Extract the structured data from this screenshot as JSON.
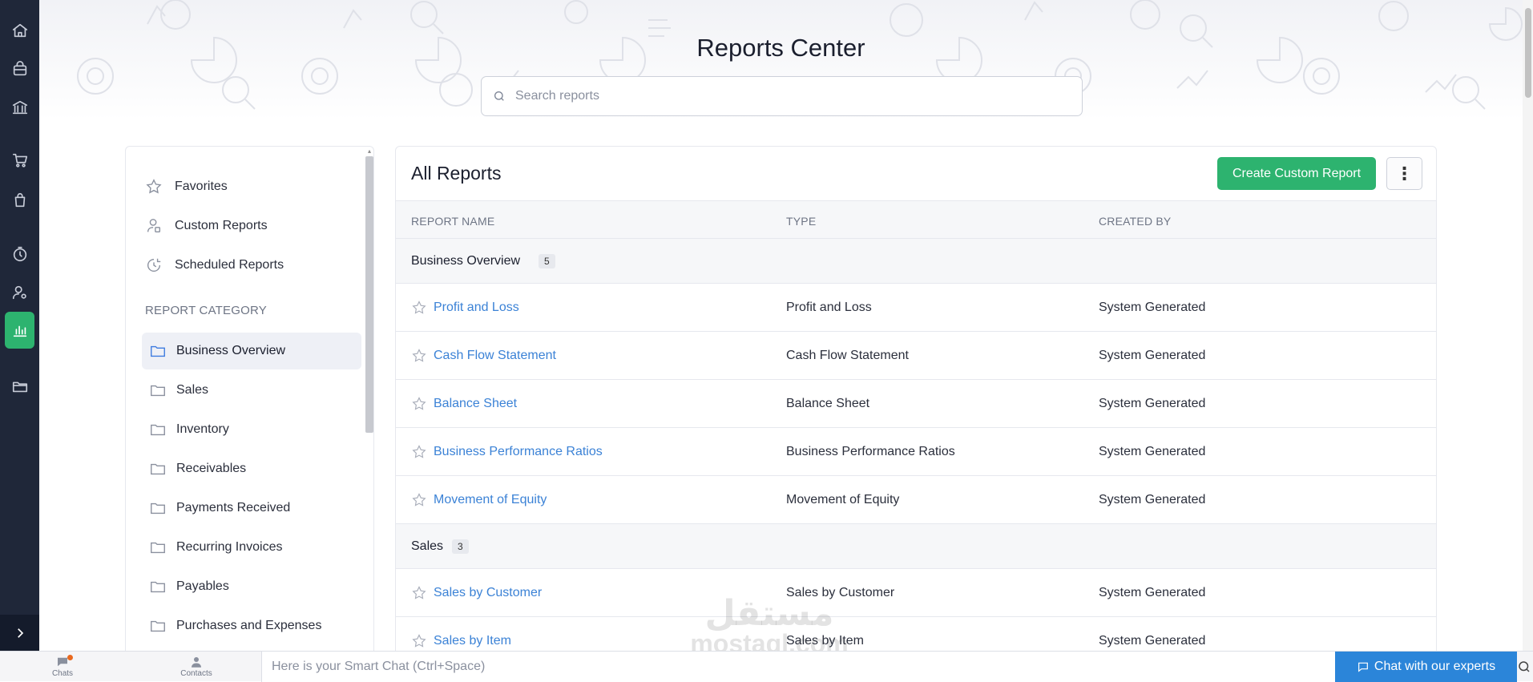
{
  "page": {
    "title": "Reports Center"
  },
  "search": {
    "placeholder": "Search reports"
  },
  "rail": {
    "items": [
      "home-icon",
      "shopping-bag-icon",
      "bank-icon",
      "cart-icon",
      "bag-icon",
      "timer-icon",
      "user-settings-icon",
      "reports-icon",
      "folder-icon"
    ],
    "active": "reports-icon",
    "active_color": "#2db36f"
  },
  "sidebar": {
    "links": [
      {
        "label": "Favorites",
        "icon": "star-icon"
      },
      {
        "label": "Custom Reports",
        "icon": "custom-report-icon"
      },
      {
        "label": "Scheduled Reports",
        "icon": "schedule-icon"
      }
    ],
    "category_heading": "REPORT CATEGORY",
    "categories": [
      {
        "label": "Business Overview",
        "active": true
      },
      {
        "label": "Sales"
      },
      {
        "label": "Inventory"
      },
      {
        "label": "Receivables"
      },
      {
        "label": "Payments Received"
      },
      {
        "label": "Recurring Invoices"
      },
      {
        "label": "Payables"
      },
      {
        "label": "Purchases and Expenses"
      }
    ]
  },
  "main": {
    "title": "All Reports",
    "create_button": "Create Custom Report",
    "columns": [
      "REPORT NAME",
      "TYPE",
      "CREATED BY"
    ],
    "groups": [
      {
        "name": "Business Overview",
        "count": "5",
        "rows": [
          {
            "name": "Profit and Loss",
            "type": "Profit and Loss",
            "created_by": "System Generated"
          },
          {
            "name": "Cash Flow Statement",
            "type": "Cash Flow Statement",
            "created_by": "System Generated"
          },
          {
            "name": "Balance Sheet",
            "type": "Balance Sheet",
            "created_by": "System Generated"
          },
          {
            "name": "Business Performance Ratios",
            "type": "Business Performance Ratios",
            "created_by": "System Generated"
          },
          {
            "name": "Movement of Equity",
            "type": "Movement of Equity",
            "created_by": "System Generated"
          }
        ]
      },
      {
        "name": "Sales",
        "count": "3",
        "rows": [
          {
            "name": "Sales by Customer",
            "type": "Sales by Customer",
            "created_by": "System Generated"
          },
          {
            "name": "Sales by Item",
            "type": "Sales by Item",
            "created_by": "System Generated"
          }
        ]
      }
    ]
  },
  "bottombar": {
    "chats_label": "Chats",
    "contacts_label": "Contacts",
    "smart_chat_placeholder": "Here is your Smart Chat (Ctrl+Space)",
    "chat_experts_label": "Chat with our experts"
  },
  "watermark": {
    "line1": "مستقل",
    "line2": "mostaql.com"
  }
}
